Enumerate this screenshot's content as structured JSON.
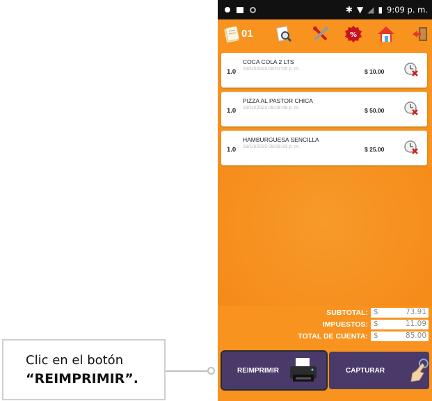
{
  "status_bar": {
    "time": "9:09 p. m."
  },
  "toolbar": {
    "table_number": "01"
  },
  "items": [
    {
      "qty": "1.0",
      "name": "COCA COLA 2 LTS",
      "datetime": "19/10/2023 08:07:05 p. m.",
      "price": "$ 10.00"
    },
    {
      "qty": "1.0",
      "name": "PIZZA AL PASTOR CHICA",
      "datetime": "19/10/2023 08:08:49 p. m.",
      "price": "$ 50.00"
    },
    {
      "qty": "1.0",
      "name": "HAMBURGUESA SENCILLA",
      "datetime": "19/10/2023 08:09:33 p. m.",
      "price": "$ 25.00"
    }
  ],
  "totals": {
    "subtotal_label": "SUBTOTAL:",
    "subtotal_currency": "$",
    "subtotal_value": "73.91",
    "taxes_label": "IMPUESTOS:",
    "taxes_currency": "$",
    "taxes_value": "11.09",
    "total_label": "TOTAL DE CUENTA:",
    "total_currency": "$",
    "total_value": "85.00"
  },
  "buttons": {
    "reprint_label": "REIMPRIMIR",
    "capture_label": "CAPTURAR"
  },
  "annotation": {
    "line1": "Clic en el botón",
    "line2": "“REIMPRIMIR”."
  },
  "icons": {
    "statusbar": [
      "dot-icon",
      "image-icon",
      "circle-icon",
      "bluetooth-icon",
      "wifi-icon",
      "signal-icon",
      "battery-icon"
    ],
    "toolbar": [
      "notepad-icon",
      "search-document-icon",
      "tools-icon",
      "discount-icon",
      "home-icon",
      "exit-door-icon"
    ]
  },
  "colors": {
    "accent_orange": "#f7931e",
    "button_purple": "#4a3a6a",
    "statusbar_black": "#111111"
  }
}
